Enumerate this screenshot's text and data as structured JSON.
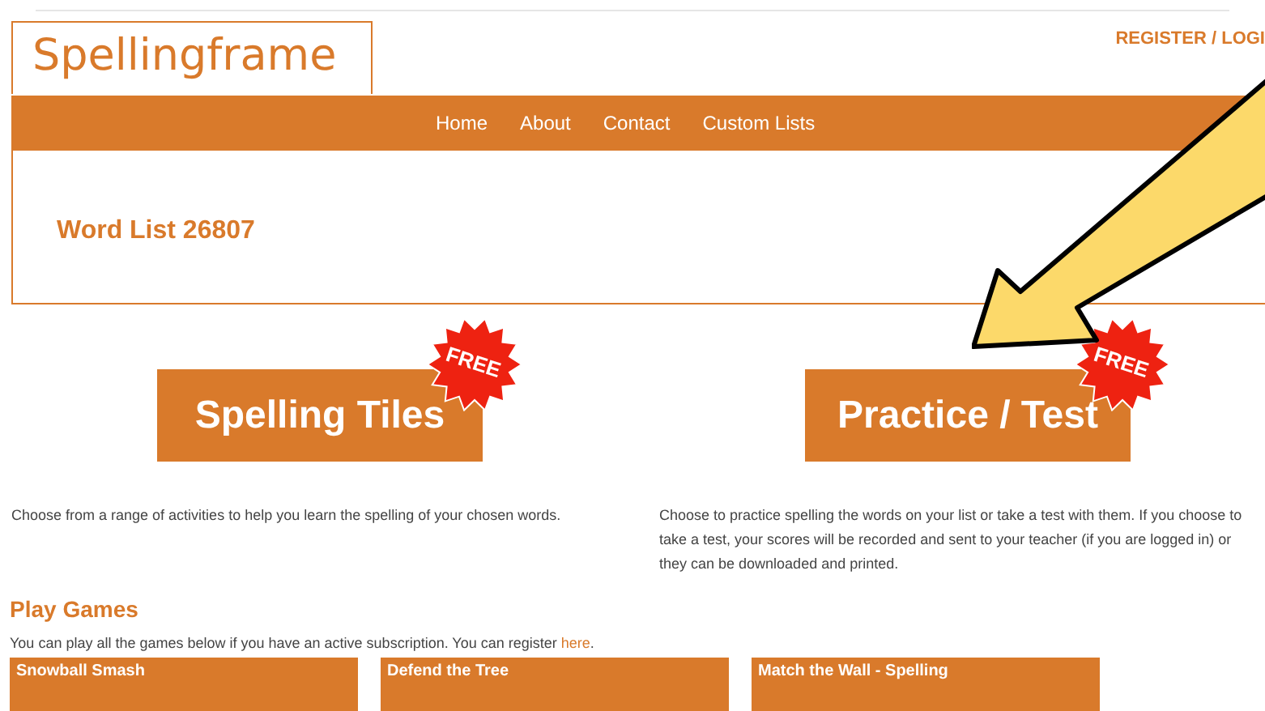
{
  "header": {
    "logo": "Spellingframe",
    "account_links": "REGISTER / LOGI"
  },
  "nav": {
    "items": [
      "Home",
      "About",
      "Contact",
      "Custom Lists"
    ]
  },
  "page_title": "Word List 26807",
  "activities": [
    {
      "label": "Spelling Tiles",
      "badge": "FREE",
      "description": "Choose from a range of activities to help you learn the spelling of your chosen words."
    },
    {
      "label": "Practice / Test",
      "badge": "FREE",
      "description": "Choose to practice spelling the words on your list or take a test with them. If you choose to take a test, your scores will be recorded and sent to your teacher (if you are logged in) or they can be downloaded and printed."
    }
  ],
  "games_section": {
    "title": "Play Games",
    "intro": "You can play all the games below if you have an active subscription. You can register",
    "link": "here",
    "intro_end": ".",
    "games": [
      "Snowball Smash",
      "Defend the Tree",
      "Match the Wall - Spelling"
    ]
  }
}
